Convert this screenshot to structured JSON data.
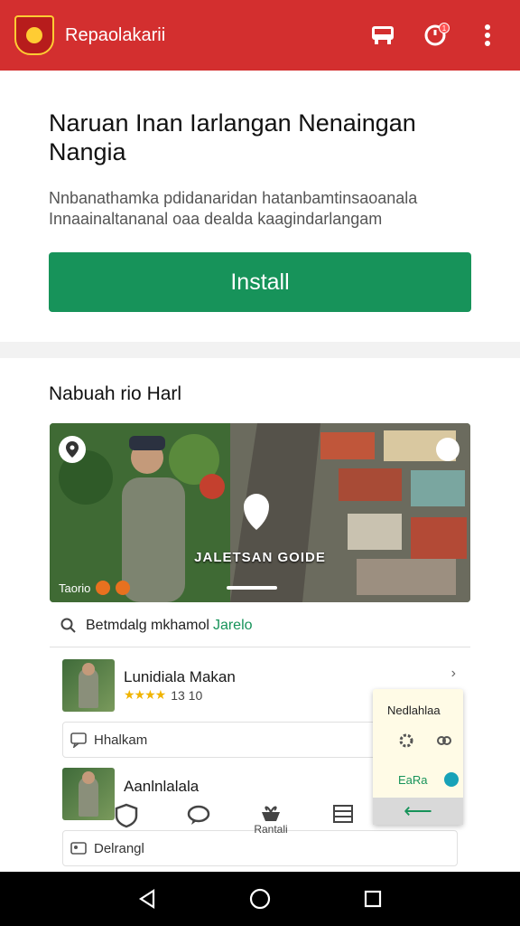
{
  "appbar": {
    "title": "Repaolakarii",
    "icons": [
      "logo-crest",
      "bus-icon",
      "timer-icon",
      "more-vert-icon"
    ],
    "notification_badge": "1",
    "color": "#d32f2f"
  },
  "install_card": {
    "headline": "Naruan Inan Iarlangan Nenaingan Nangia",
    "description": "Nnbanathamka pdidanaridan hatanbamtinsaoanala Innaainaltananal oaa dealda kaagindarlangam",
    "install_label": "Install",
    "button_color": "#17935a"
  },
  "section": {
    "title": "Nabuah rio Harl",
    "media": {
      "caption": "JALETSAN GOIDE",
      "footer_text": "Taorio"
    },
    "search_text": "Betmdalg mkhamol",
    "search_accent": "Jarelo",
    "items": [
      {
        "title": "Lunidiala Makan",
        "stars": "★★★★",
        "meta": "13 10",
        "rating": "★★ ⁿ"
      },
      {
        "title": "Aanlnlalala",
        "stars": "",
        "meta": "",
        "rating": ""
      }
    ],
    "subrows": [
      "Hhalkam",
      "Delrangl"
    ]
  },
  "popover": {
    "title": "Nedlahlaa",
    "rate_label": "EaRa",
    "back_icon": "arrow-left-icon"
  },
  "tabbar": {
    "tabs": [
      {
        "icon": "shield-icon",
        "label": ""
      },
      {
        "icon": "chat-icon",
        "label": ""
      },
      {
        "icon": "gift-icon",
        "label": "Rantali"
      },
      {
        "icon": "list-icon",
        "label": ""
      }
    ]
  },
  "navbar": {
    "buttons": [
      "back-icon",
      "home-icon",
      "recents-icon"
    ]
  }
}
